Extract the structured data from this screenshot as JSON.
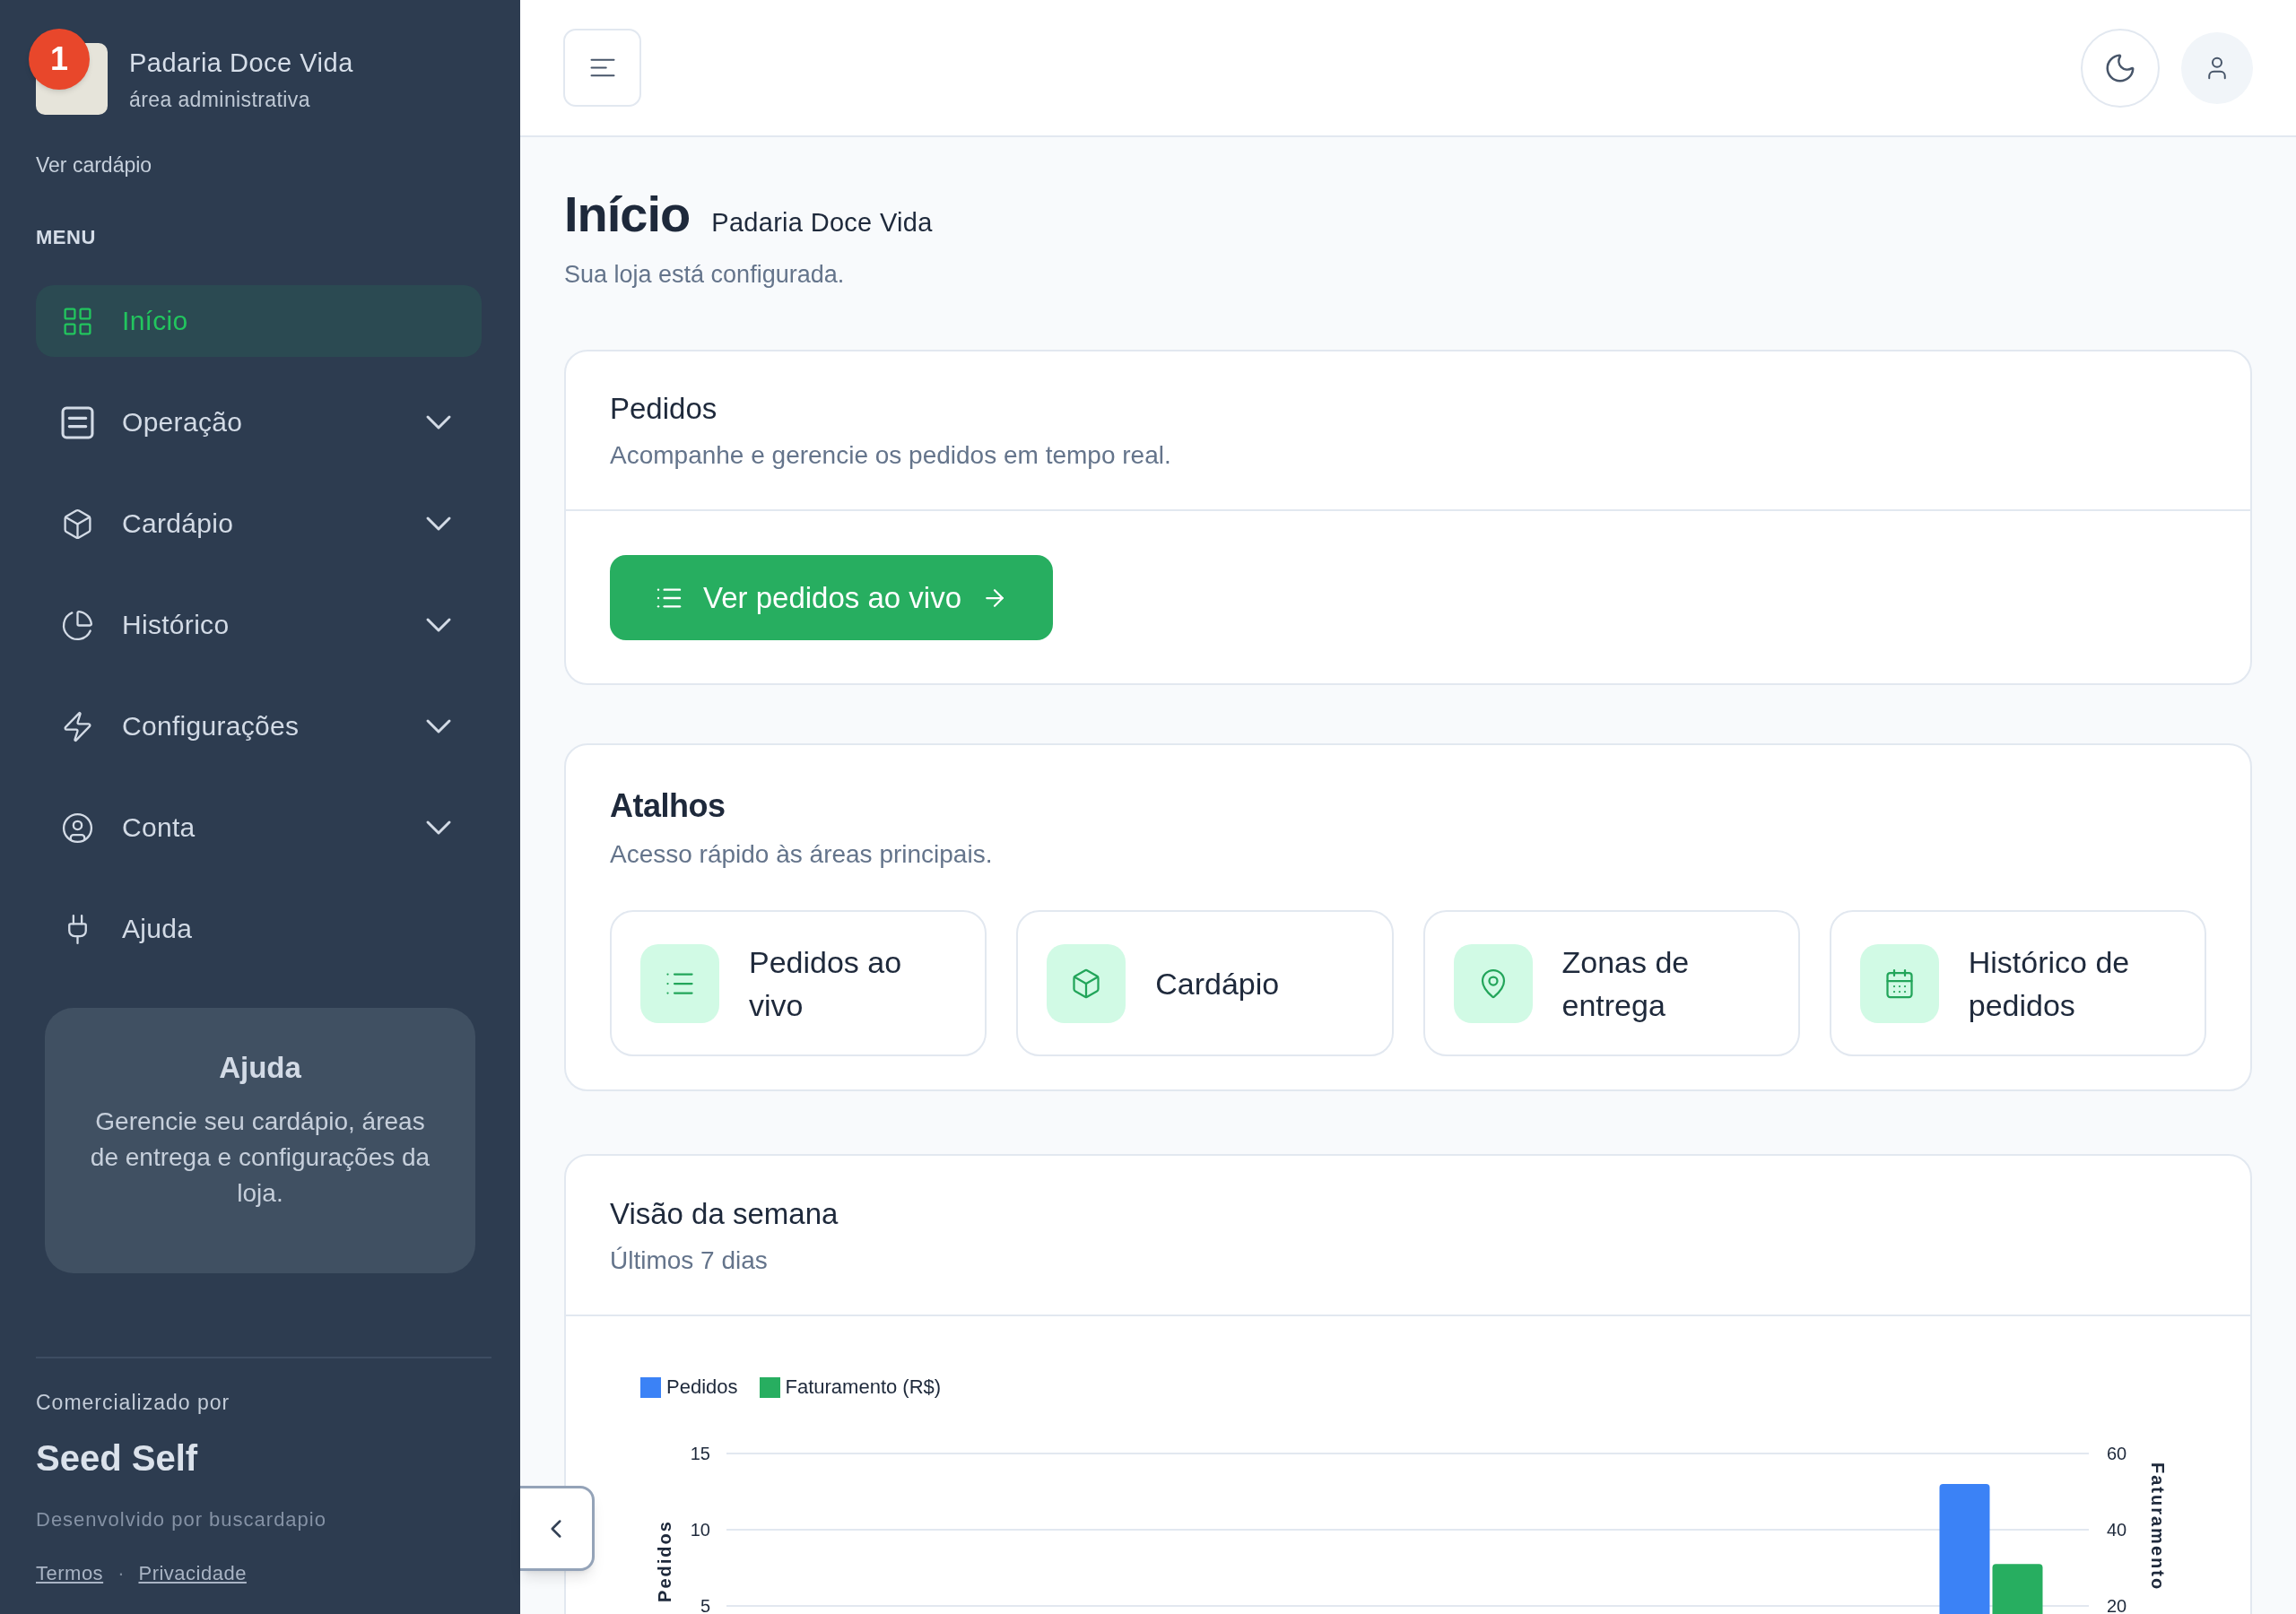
{
  "sidebar": {
    "brand": {
      "name": "Padaria Doce Vida",
      "subtitle": "área administrativa",
      "badge": "1"
    },
    "menu_link": "Ver cardápio",
    "section_label": "MENU",
    "items": [
      {
        "label": "Início",
        "kind": "link",
        "selected": true
      },
      {
        "label": "Operação",
        "kind": "group",
        "selected": false,
        "expanded": false
      },
      {
        "label": "Cardápio",
        "kind": "group",
        "selected": false,
        "expanded": false
      },
      {
        "label": "Histórico",
        "kind": "group",
        "selected": false,
        "expanded": false
      },
      {
        "label": "Configurações",
        "kind": "group",
        "selected": false,
        "expanded": false
      },
      {
        "label": "Conta",
        "kind": "group",
        "selected": false,
        "expanded": false
      },
      {
        "label": "Ajuda",
        "kind": "link",
        "selected": false
      }
    ],
    "help_card": {
      "title": "Ajuda",
      "text": "Gerencie seu cardápio, áreas de entrega e configurações da loja."
    },
    "footer": {
      "caption": "Comercializado por",
      "brand": "Seed Self",
      "credit": "Desenvolvido por buscardapio",
      "links": [
        "Termos",
        "Privacidade"
      ],
      "separator": "·"
    }
  },
  "page": {
    "title": "Início",
    "subtitle": "Padaria Doce Vida",
    "status": "Sua loja está configurada."
  },
  "orders_card": {
    "title": "Pedidos",
    "subtitle": "Acompanhe e gerencie os pedidos em tempo real.",
    "button": "Ver pedidos ao vivo"
  },
  "shortcuts": {
    "title": "Atalhos",
    "subtitle": "Acesso rápido às áreas principais.",
    "items": [
      "Pedidos ao vivo",
      "Cardápio",
      "Zonas de entrega",
      "Histórico de pedidos"
    ]
  },
  "week_card": {
    "title": "Visão da semana",
    "subtitle": "Últimos 7 dias",
    "chart_data": {
      "type": "bar",
      "legend": "top-left",
      "ylabel": "Pedidos",
      "y2label": "Faturamento",
      "ylim": [
        0,
        15
      ],
      "y2lim": [
        0,
        60
      ],
      "yticks": [
        5,
        10,
        15
      ],
      "y2ticks": [
        20,
        40,
        60
      ],
      "series": [
        {
          "name": "Pedidos",
          "color": "#3b82f6",
          "axis": "y",
          "values": [
            0,
            0,
            0,
            0,
            0,
            0,
            13
          ]
        },
        {
          "name": "Faturamento (R$)",
          "color": "#27ae60",
          "axis": "y2",
          "values": [
            0,
            0,
            0,
            0,
            0,
            0,
            31
          ]
        }
      ]
    }
  }
}
